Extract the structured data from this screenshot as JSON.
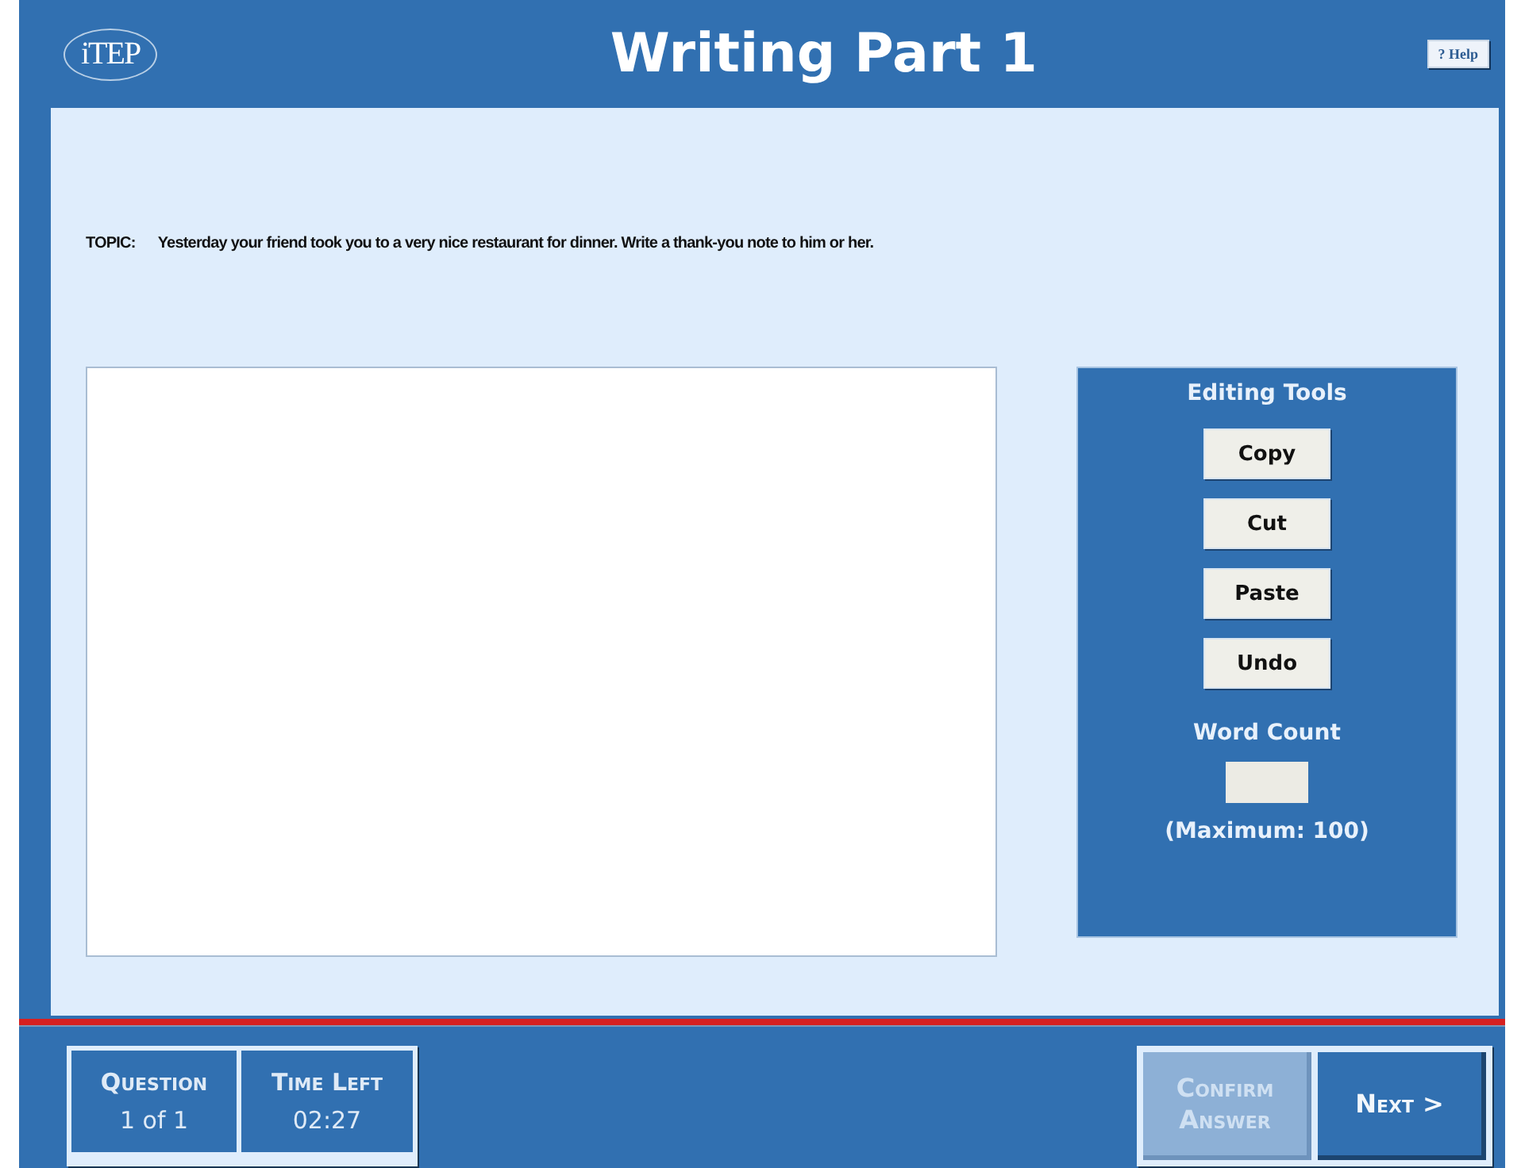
{
  "header": {
    "logo": "iTEP",
    "title": "Writing Part 1",
    "help_button": "? Help"
  },
  "topic": {
    "label": "TOPIC:",
    "text": "Yesterday your friend took you to a very nice restaurant for dinner. Write a thank-you note to him or her."
  },
  "editing_tools": {
    "title": "Editing Tools",
    "buttons": [
      "Copy",
      "Cut",
      "Paste",
      "Undo"
    ],
    "word_count_label": "Word Count",
    "maximum": "(Maximum: 100)"
  },
  "status": [
    {
      "label": "Question",
      "value": "1 of 1"
    },
    {
      "label": "Time Left",
      "value": "02:27"
    }
  ],
  "nav_buttons": [
    {
      "label": "Confirm Answer",
      "disabled": true
    },
    {
      "label": "Next >",
      "disabled": false
    }
  ]
}
